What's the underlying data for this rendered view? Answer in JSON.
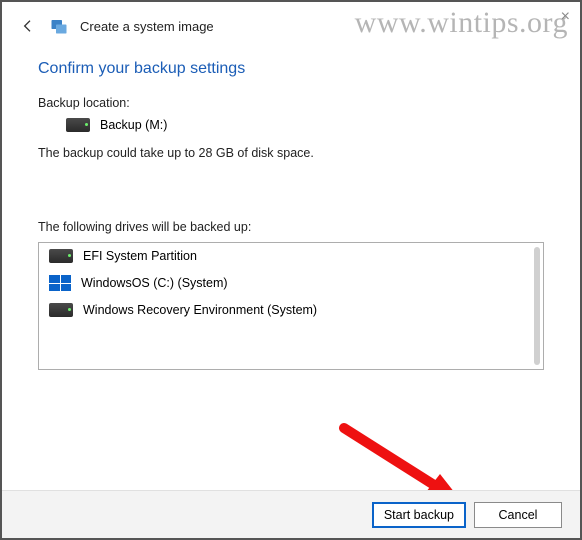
{
  "watermark": "www.wintips.org",
  "window": {
    "title": "Create a system image"
  },
  "heading": "Confirm your backup settings",
  "backup_location": {
    "label": "Backup location:",
    "value": "Backup (M:)"
  },
  "size_note": "The backup could take up to 28 GB of disk space.",
  "drives": {
    "label": "The following drives will be backed up:",
    "items": [
      {
        "name": "EFI System Partition",
        "icon": "hdd"
      },
      {
        "name": "WindowsOS (C:) (System)",
        "icon": "windows"
      },
      {
        "name": "Windows Recovery Environment (System)",
        "icon": "hdd"
      }
    ]
  },
  "buttons": {
    "start": "Start backup",
    "cancel": "Cancel"
  }
}
